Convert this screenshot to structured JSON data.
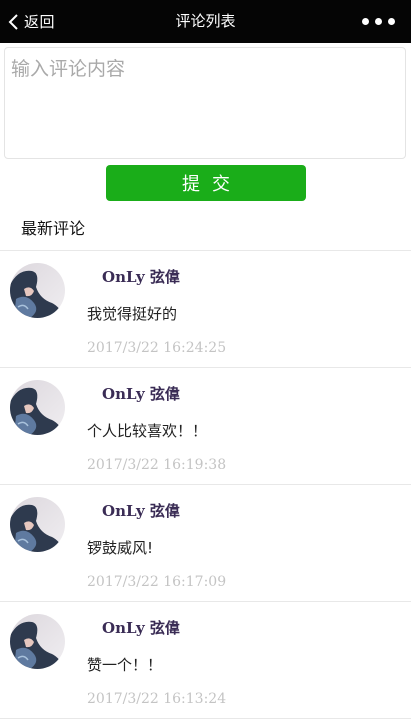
{
  "navbar": {
    "back_label": "返回",
    "title": "评论列表"
  },
  "composer": {
    "placeholder": "输入评论内容",
    "value": "",
    "submit_label": "提交"
  },
  "section": {
    "title": "最新评论"
  },
  "comments": [
    {
      "user": "OnLy 弦偉",
      "text": "我觉得挺好的",
      "time": "2017/3/22 16:24:25"
    },
    {
      "user": "OnLy 弦偉",
      "text": "个人比较喜欢！！",
      "time": "2017/3/22 16:19:38"
    },
    {
      "user": "OnLy 弦偉",
      "text": "锣鼓威风!",
      "time": "2017/3/22 16:17:09"
    },
    {
      "user": "OnLy 弦偉",
      "text": "赞一个！！",
      "time": "2017/3/22 16:13:24"
    }
  ],
  "icons": {
    "back": "chevron-left-icon",
    "more": "more-dots-icon"
  },
  "colors": {
    "navbar_bg": "#050505",
    "submit_bg": "#1aad19",
    "username": "#3a2c55",
    "timestamp": "#c4c4c4"
  }
}
